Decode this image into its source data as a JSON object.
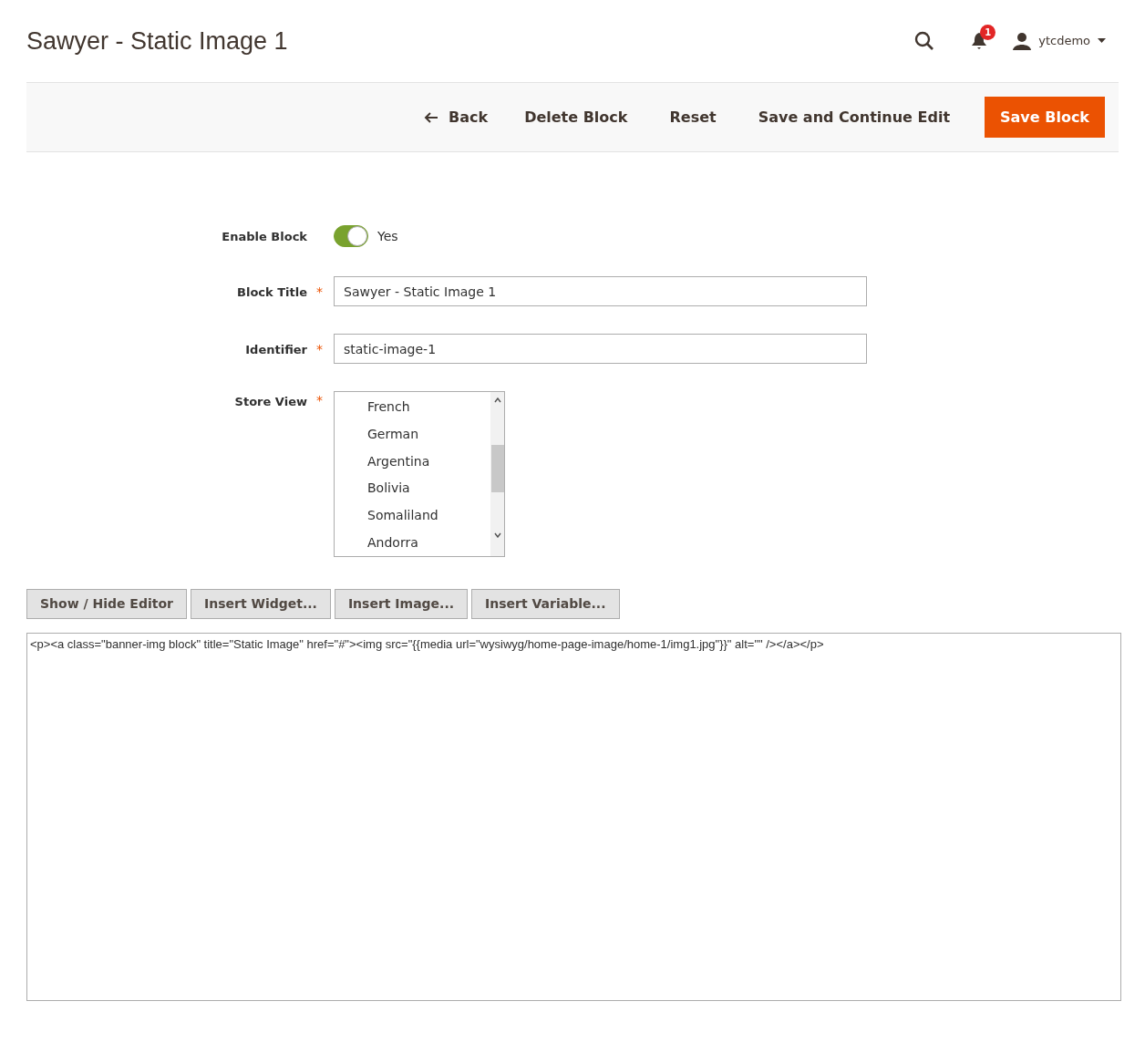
{
  "page_title": "Sawyer - Static Image 1",
  "header": {
    "notification_count": "1",
    "user": "ytcdemo"
  },
  "actions": [
    {
      "label": "Back",
      "kind": "back"
    },
    {
      "label": "Delete Block",
      "kind": "plain"
    },
    {
      "label": "Reset",
      "kind": "plain"
    },
    {
      "label": "Save and Continue Edit",
      "kind": "plain"
    },
    {
      "label": "Save Block",
      "kind": "primary"
    }
  ],
  "enable_block": {
    "label": "Enable Block",
    "on": true,
    "value_label": "Yes"
  },
  "block_title": {
    "label": "Block Title",
    "required_mark": "*",
    "value": "Sawyer - Static Image 1"
  },
  "identifier": {
    "label": "Identifier",
    "required_mark": "*",
    "value": "static-image-1"
  },
  "store_view": {
    "label": "Store View",
    "required_mark": "*",
    "options": [
      {
        "label": "French",
        "selected": false
      },
      {
        "label": "German",
        "selected": false
      },
      {
        "label": "Argentina",
        "selected": false
      },
      {
        "label": "Bolivia",
        "selected": false
      },
      {
        "label": "Somaliland",
        "selected": false
      },
      {
        "label": "Andorra",
        "selected": false
      }
    ]
  },
  "editor_buttons": [
    "Show / Hide Editor",
    "Insert Widget...",
    "Insert Image...",
    "Insert Variable..."
  ],
  "content": "<p><a class=\"banner-img block\" title=\"Static Image\" href=\"#\"><img src=\"{{media url=\"wysiwyg/home-page-image/home-1/img1.jpg\"}}\" alt=\"\" /></a></p>"
}
